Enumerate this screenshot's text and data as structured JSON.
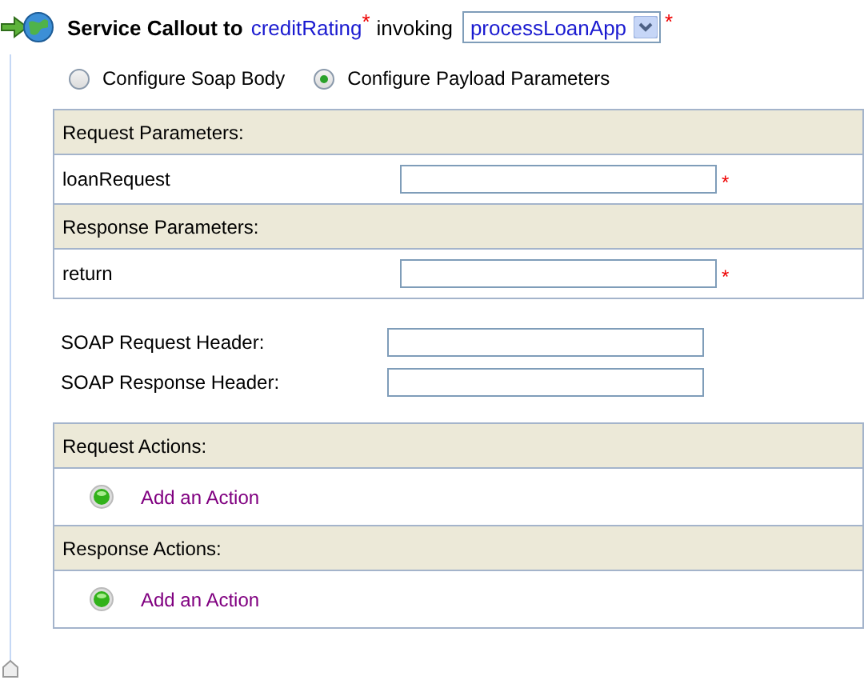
{
  "header": {
    "title": "Service Callout to",
    "service": "creditRating",
    "service_required_mark": "*",
    "verb": "invoking",
    "operation": "processLoanApp",
    "operation_required_mark": "*"
  },
  "mode_options": [
    {
      "label": "Configure Soap Body",
      "selected": false
    },
    {
      "label": "Configure Payload Parameters",
      "selected": true
    }
  ],
  "parameters": [
    {
      "kind": "header",
      "label": "Request Parameters:"
    },
    {
      "kind": "field",
      "label": "loanRequest",
      "required_mark": "*"
    },
    {
      "kind": "header",
      "label": "Response Parameters:"
    },
    {
      "kind": "field",
      "label": "return",
      "required_mark": "*"
    }
  ],
  "soap_headers": [
    {
      "label": "SOAP Request Header:"
    },
    {
      "label": "SOAP Response Header:"
    }
  ],
  "actions": [
    {
      "kind": "header",
      "label": "Request Actions:"
    },
    {
      "kind": "action",
      "link": "Add an Action"
    },
    {
      "kind": "header",
      "label": "Response Actions:"
    },
    {
      "kind": "action",
      "link": "Add an Action"
    }
  ]
}
